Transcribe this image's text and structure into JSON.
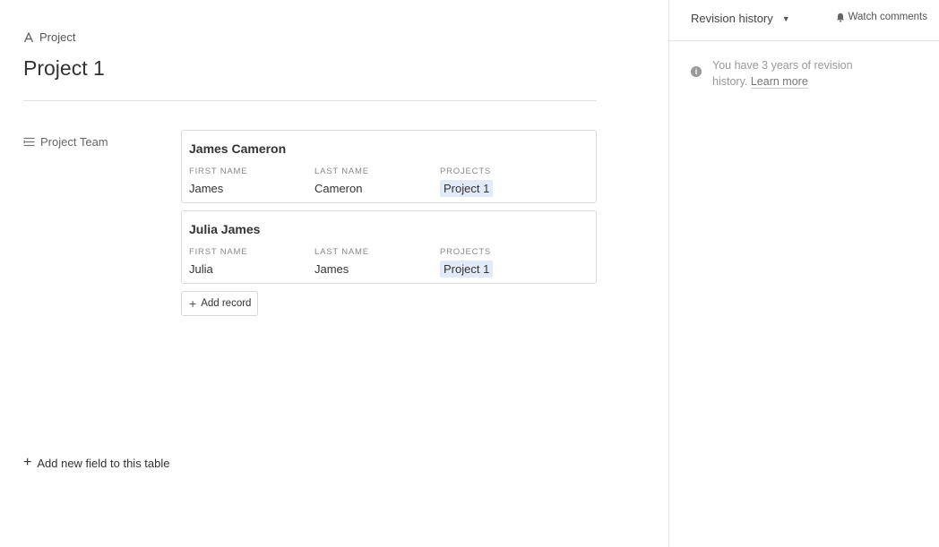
{
  "header": {
    "table_name": "Project",
    "record_title": "Project 1"
  },
  "field": {
    "label": "Project Team"
  },
  "records": [
    {
      "title": "James Cameron",
      "first_name_label": "FIRST NAME",
      "first_name": "James",
      "last_name_label": "LAST NAME",
      "last_name": "Cameron",
      "projects_label": "PROJECTS",
      "project": "Project 1"
    },
    {
      "title": "Julia James",
      "first_name_label": "FIRST NAME",
      "first_name": "Julia",
      "last_name_label": "LAST NAME",
      "last_name": "James",
      "projects_label": "PROJECTS",
      "project": "Project 1"
    }
  ],
  "add_record_label": "Add record",
  "add_field_label": "Add new field to this table",
  "sidebar": {
    "revision_history_label": "Revision history",
    "watch_comments_label": "Watch comments",
    "info_prefix": "You have 3 years of revision history.",
    "learn_more": "Learn more"
  },
  "colors": {
    "pill_bg": "#e2eaf7",
    "border": "#dcdcdc",
    "muted_text": "#999999"
  },
  "icons": [
    "primary-field-icon",
    "linked-field-icon",
    "plus-icon",
    "caret-down-icon",
    "bell-icon",
    "info-icon"
  ]
}
